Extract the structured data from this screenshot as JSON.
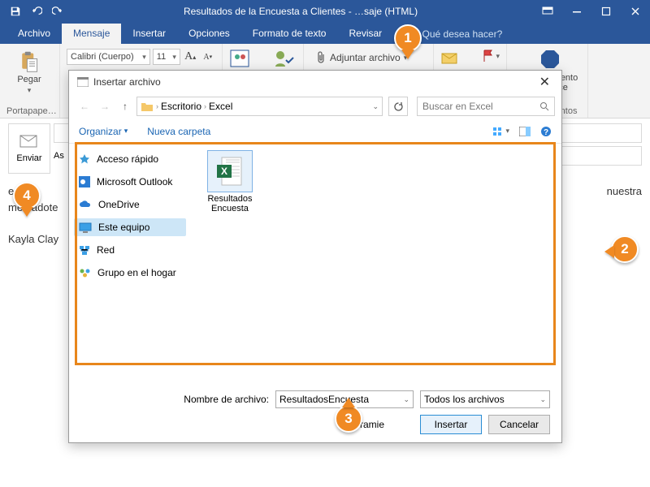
{
  "titlebar": {
    "title": "Resultados de la Encuesta a Clientes - …saje (HTML)"
  },
  "tabs": {
    "file": "Archivo",
    "message": "Mensaje",
    "insert": "Insertar",
    "options": "Opciones",
    "format": "Formato de texto",
    "review": "Revisar",
    "tell": "¿Qué desea hacer?"
  },
  "ribbon": {
    "paste": "Pegar",
    "clipboard_label": "Portapape…",
    "font_name": "Calibri (Cuerpo)",
    "font_size": "11",
    "attach": "Adjuntar archivo",
    "addins_line1": "Complemento",
    "addins_line2": "de Office",
    "addins_group": "Complementos"
  },
  "compose": {
    "send": "Enviar",
    "subject_hint": "As",
    "body_line1": "están",
    "body_line2": "mercadote",
    "body_line3": "Kayla Clay",
    "body_right": "nuestra"
  },
  "dialog": {
    "title": "Insertar archivo",
    "crumb1": "Escritorio",
    "crumb2": "Excel",
    "search_placeholder": "Buscar en Excel",
    "organize": "Organizar",
    "new_folder": "Nueva carpeta",
    "side": {
      "quick": "Acceso rápido",
      "outlook": "Microsoft Outlook",
      "onedrive": "OneDrive",
      "thispc": "Este equipo",
      "network": "Red",
      "homegroup": "Grupo en el hogar"
    },
    "file": {
      "line1": "Resultados",
      "line2": "Encuesta"
    },
    "filename_label": "Nombre de archivo:",
    "filename_value": "ResultadosEncuesta",
    "filter": "Todos los archivos",
    "tools": "Herramie",
    "insert": "Insertar",
    "cancel": "Cancelar"
  },
  "callouts": {
    "c1": "1",
    "c2": "2",
    "c3": "3",
    "c4": "4"
  }
}
